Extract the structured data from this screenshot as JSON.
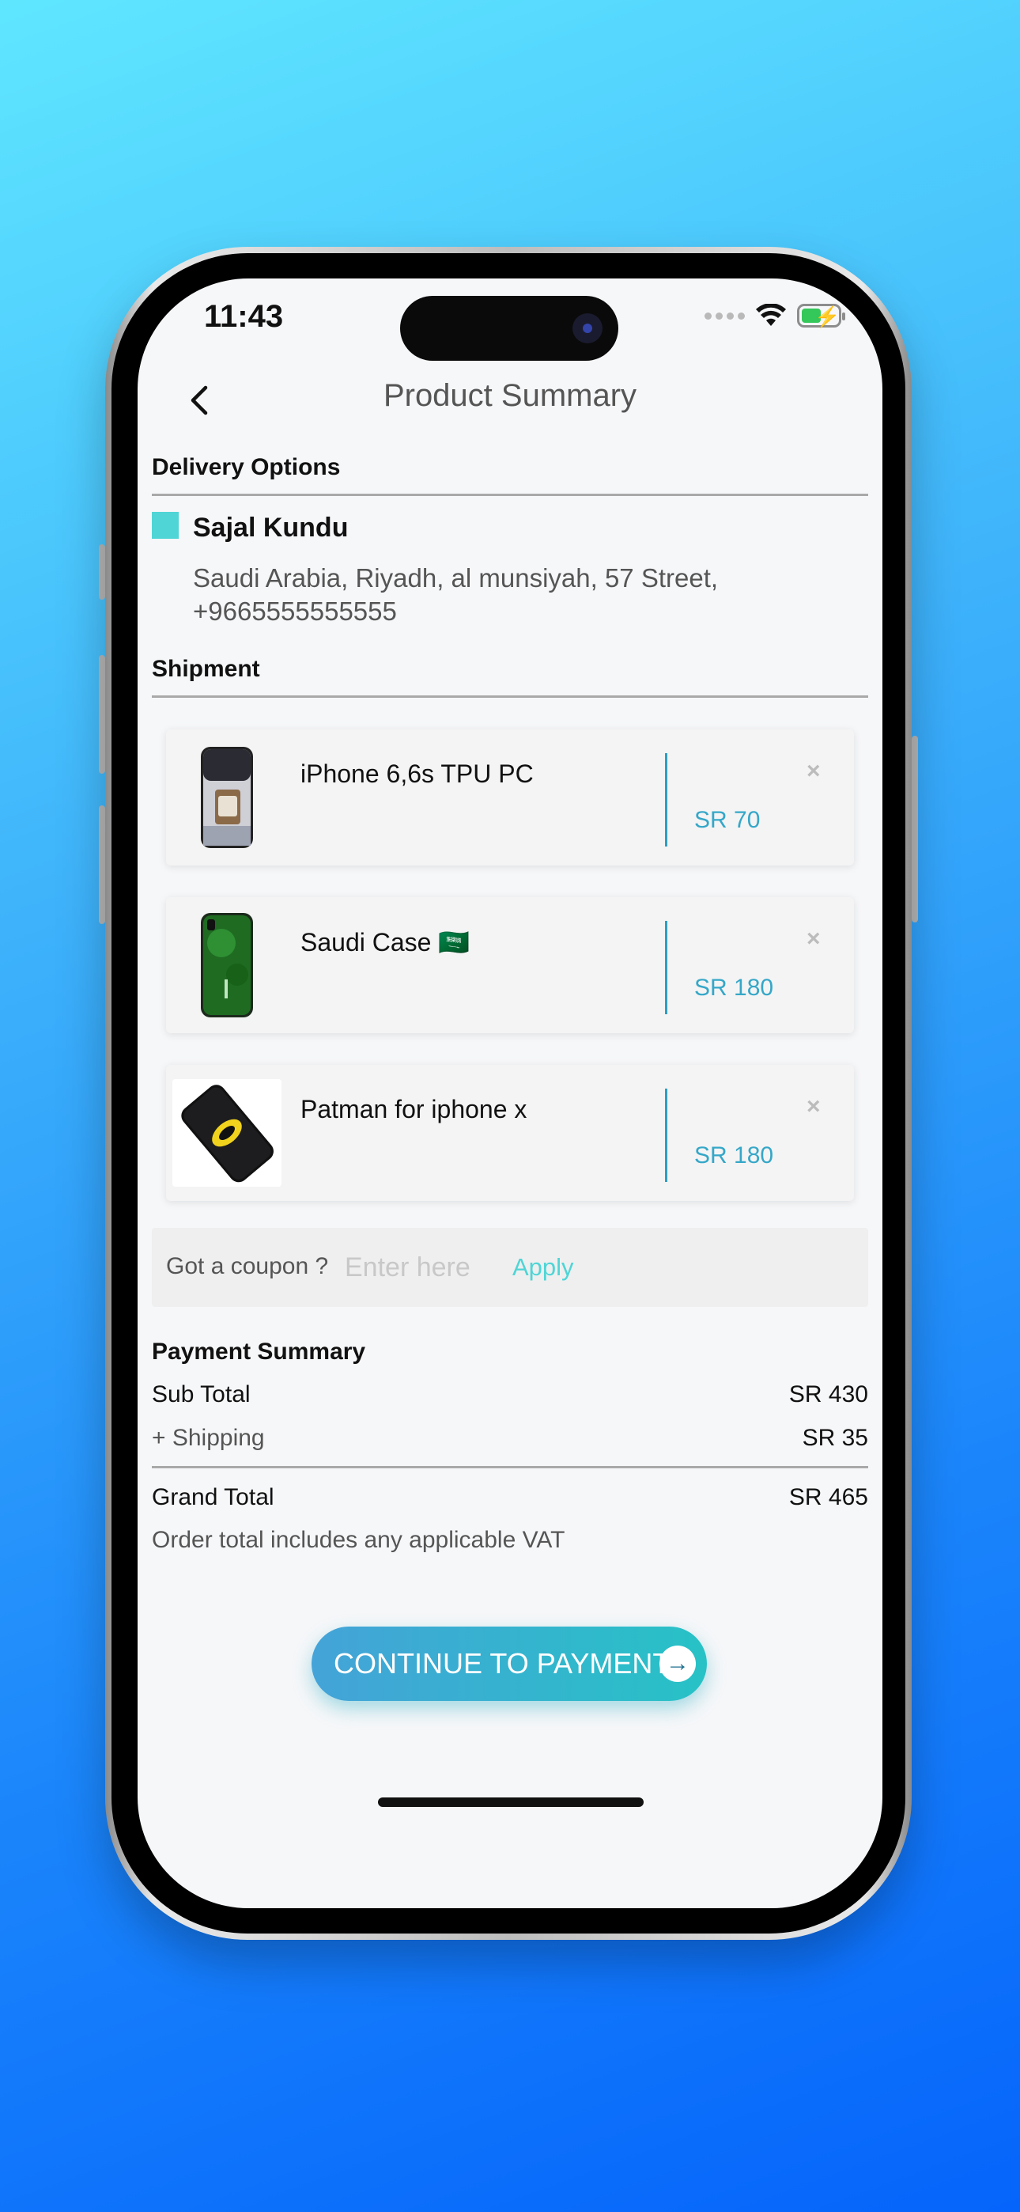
{
  "status_bar": {
    "time": "11:43"
  },
  "header": {
    "title": "Product Summary"
  },
  "delivery": {
    "section_title": "Delivery Options",
    "name": "Sajal Kundu",
    "address_line1": "Saudi Arabia,  Riyadh,  al munsiyah, 57 Street,",
    "address_line2": "+9665555555555"
  },
  "shipment": {
    "section_title": "Shipment",
    "items": [
      {
        "name": "iPhone 6,6s TPU PC",
        "price": "SR 70",
        "remove": "×"
      },
      {
        "name": "Saudi Case 🇸🇦",
        "price": "SR 180",
        "remove": "×"
      },
      {
        "name": "Patman for iphone x",
        "price": "SR 180",
        "remove": "×"
      }
    ]
  },
  "coupon": {
    "label": "Got a coupon ?",
    "placeholder": "Enter here",
    "apply": "Apply"
  },
  "payment": {
    "section_title": "Payment Summary",
    "subtotal_label": "Sub Total",
    "subtotal_value": "SR 430",
    "shipping_label": "+ Shipping",
    "shipping_value": "SR 35",
    "grand_label": "Grand Total",
    "grand_value": "SR 465",
    "vat_note": "Order total includes any applicable VAT"
  },
  "cta": {
    "label": "CONTINUE TO PAYMENT",
    "icon": "→"
  },
  "colors": {
    "accent": "#4fd5d6",
    "price": "#35a7c8",
    "cta_start": "#44a3d8",
    "cta_end": "#27c2c6"
  }
}
